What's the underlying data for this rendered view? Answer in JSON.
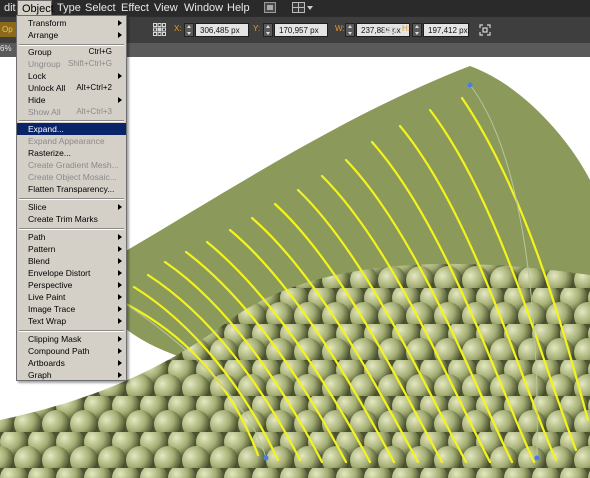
{
  "menubar": {
    "items": [
      "dit",
      "Object",
      "Type",
      "Select",
      "Effect",
      "View",
      "Window",
      "Help"
    ]
  },
  "control_bar": {
    "x_label": "X:",
    "x_value": "306,485 px",
    "y_label": "Y:",
    "y_value": "170,957 px",
    "w_label": "W:",
    "w_value": "237,885 px",
    "h_label": "H:",
    "h_value": "197,412 px",
    "left_fragment": "Op",
    "zoom_fragment": "6%"
  },
  "object_menu": [
    {
      "label": "Transform",
      "submenu": true
    },
    {
      "label": "Arrange",
      "submenu": true
    },
    {
      "label": "Group",
      "shortcut": "Ctrl+G"
    },
    {
      "label": "Ungroup",
      "shortcut": "Shift+Ctrl+G",
      "disabled": true
    },
    {
      "label": "Lock",
      "submenu": true
    },
    {
      "label": "Unlock All",
      "shortcut": "Alt+Ctrl+2"
    },
    {
      "label": "Hide",
      "submenu": true
    },
    {
      "label": "Show All",
      "shortcut": "Alt+Ctrl+3",
      "disabled": true
    },
    {
      "label": "Expand...",
      "highlighted": true
    },
    {
      "label": "Expand Appearance",
      "disabled": true
    },
    {
      "label": "Rasterize..."
    },
    {
      "label": "Create Gradient Mesh...",
      "disabled": true
    },
    {
      "label": "Create Object Mosaic...",
      "disabled": true
    },
    {
      "label": "Flatten Transparency..."
    },
    {
      "label": "Slice",
      "submenu": true
    },
    {
      "label": "Create Trim Marks"
    },
    {
      "label": "Path",
      "submenu": true
    },
    {
      "label": "Pattern",
      "submenu": true
    },
    {
      "label": "Blend",
      "submenu": true
    },
    {
      "label": "Envelope Distort",
      "submenu": true
    },
    {
      "label": "Perspective",
      "submenu": true
    },
    {
      "label": "Live Paint",
      "submenu": true
    },
    {
      "label": "Image Trace",
      "submenu": true
    },
    {
      "label": "Text Wrap",
      "submenu": true
    },
    {
      "label": "Clipping Mask",
      "submenu": true
    },
    {
      "label": "Compound Path",
      "submenu": true
    },
    {
      "label": "Artboards",
      "submenu": true
    },
    {
      "label": "Graph",
      "submenu": true
    }
  ],
  "colors": {
    "fin_green": "#8b9a5b",
    "scale_light": "#e4e8c0",
    "scale_dark": "#3e4526",
    "stroke_yellow": "#f4f41c",
    "menu_bg": "#d4d0c8",
    "menu_highlight": "#0a246a",
    "app_chrome": "#2a2a2a"
  },
  "icons": [
    "bridge-icon",
    "arrange-documents-icon",
    "transform-reference-icon",
    "link-icon",
    "transform-menu-icon"
  ]
}
